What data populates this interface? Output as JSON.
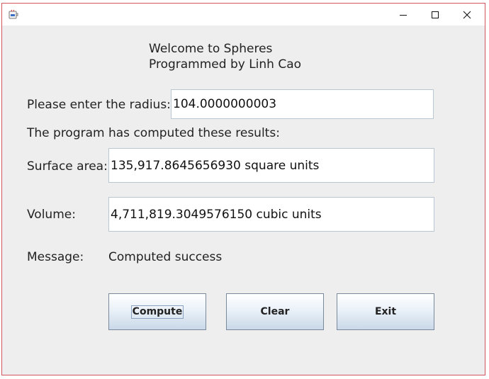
{
  "window": {
    "icon": "java-coffee-icon",
    "controls": [
      "minimize-icon",
      "maximize-icon",
      "close-icon"
    ]
  },
  "header": {
    "line1": "Welcome to Spheres",
    "line2": "Programmed by Linh Cao"
  },
  "radius": {
    "label": "Please enter the radius:",
    "value": "104.0000000003"
  },
  "results_caption": "The program has computed these results:",
  "surface": {
    "label": "Surface area:",
    "value": "135,917.8645656930 square units"
  },
  "volume": {
    "label": "Volume:",
    "value": "4,711,819.3049576150 cubic units"
  },
  "message": {
    "label": "Message:",
    "value": "Computed success"
  },
  "buttons": {
    "compute": "Compute",
    "clear": "Clear",
    "exit": "Exit"
  }
}
